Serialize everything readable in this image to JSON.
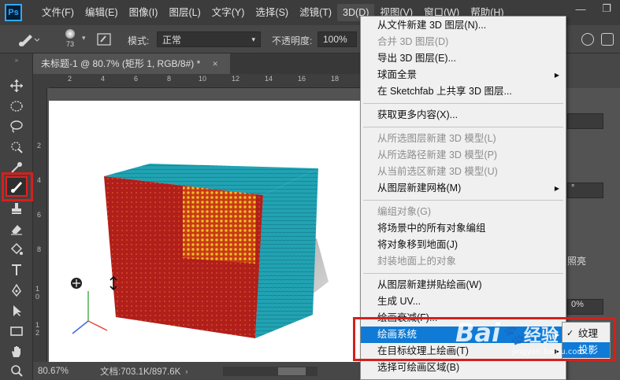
{
  "app": {
    "logo": "Ps"
  },
  "menubar": {
    "items": [
      "文件(F)",
      "编辑(E)",
      "图像(I)",
      "图层(L)",
      "文字(Y)",
      "选择(S)",
      "滤镜(T)",
      "3D(D)",
      "视图(V)",
      "窗口(W)",
      "帮助(H)"
    ]
  },
  "window_controls": {
    "minimize": "—",
    "restore": "❐"
  },
  "options_bar": {
    "brush_size": "73",
    "mode_label": "模式:",
    "mode_value": "正常",
    "opacity_label": "不透明度:",
    "opacity_value": "100%"
  },
  "document": {
    "tab_title": "未标题-1 @ 80.7% (矩形 1, RGB/8#) *",
    "close": "×"
  },
  "rulers": {
    "h_ticks": [
      "2",
      "4",
      "6",
      "8",
      "10",
      "12",
      "14",
      "16",
      "18"
    ],
    "v_ticks": [
      "2",
      "4",
      "6",
      "8",
      "1 0",
      "1 2"
    ]
  },
  "statusbar": {
    "zoom": "80.67%",
    "doc_info": "文档:703.1K/897.6K"
  },
  "menu_3d": {
    "groups": [
      [
        {
          "label": "从文件新建 3D 图层(N)...",
          "enabled": true
        },
        {
          "label": "合并 3D 图层(D)",
          "enabled": false
        },
        {
          "label": "导出 3D 图层(E)...",
          "enabled": true
        },
        {
          "label": "球面全景",
          "enabled": true,
          "submenu": true
        },
        {
          "label": "在 Sketchfab 上共享 3D 图层...",
          "enabled": true
        }
      ],
      [
        {
          "label": "获取更多内容(X)...",
          "enabled": true
        }
      ],
      [
        {
          "label": "从所选图层新建 3D 模型(L)",
          "enabled": false
        },
        {
          "label": "从所选路径新建 3D 模型(P)",
          "enabled": false
        },
        {
          "label": "从当前选区新建 3D 模型(U)",
          "enabled": false
        },
        {
          "label": "从图层新建网格(M)",
          "enabled": true,
          "submenu": true
        }
      ],
      [
        {
          "label": "编组对象(G)",
          "enabled": false
        },
        {
          "label": "将场景中的所有对象编组",
          "enabled": true
        },
        {
          "label": "将对象移到地面(J)",
          "enabled": true
        },
        {
          "label": "封装地面上的对象",
          "enabled": false
        }
      ],
      [
        {
          "label": "从图层新建拼贴绘画(W)",
          "enabled": true
        },
        {
          "label": "生成 UV...",
          "enabled": true
        },
        {
          "label": "绘画衰减(F)...",
          "enabled": true
        },
        {
          "label": "绘画系统",
          "enabled": true,
          "submenu": true,
          "highlighted": true
        },
        {
          "label": "在目标纹理上绘画(T)",
          "enabled": true,
          "submenu": true
        },
        {
          "label": "选择可绘画区域(B)",
          "enabled": true
        }
      ]
    ]
  },
  "submenu_paint_system": {
    "items": [
      {
        "label": "纹理",
        "checked": true
      },
      {
        "label": "投影",
        "checked": false,
        "highlighted": true
      }
    ]
  },
  "right_panel": {
    "partial_text": [
      "°",
      "照亮",
      "0%"
    ]
  },
  "watermark": {
    "brand": "Bai",
    "paw": "🐾",
    "suffix": "经验",
    "url": "jingyan.baidu.com"
  },
  "colors": {
    "accent_highlight": "#0f7bd6",
    "annotation_red": "#d3211d",
    "ps_blue": "#31a8ff",
    "cube_front": "#b01f1a",
    "cube_top": "#21a3b3",
    "cube_highlight": "#f0c020"
  }
}
